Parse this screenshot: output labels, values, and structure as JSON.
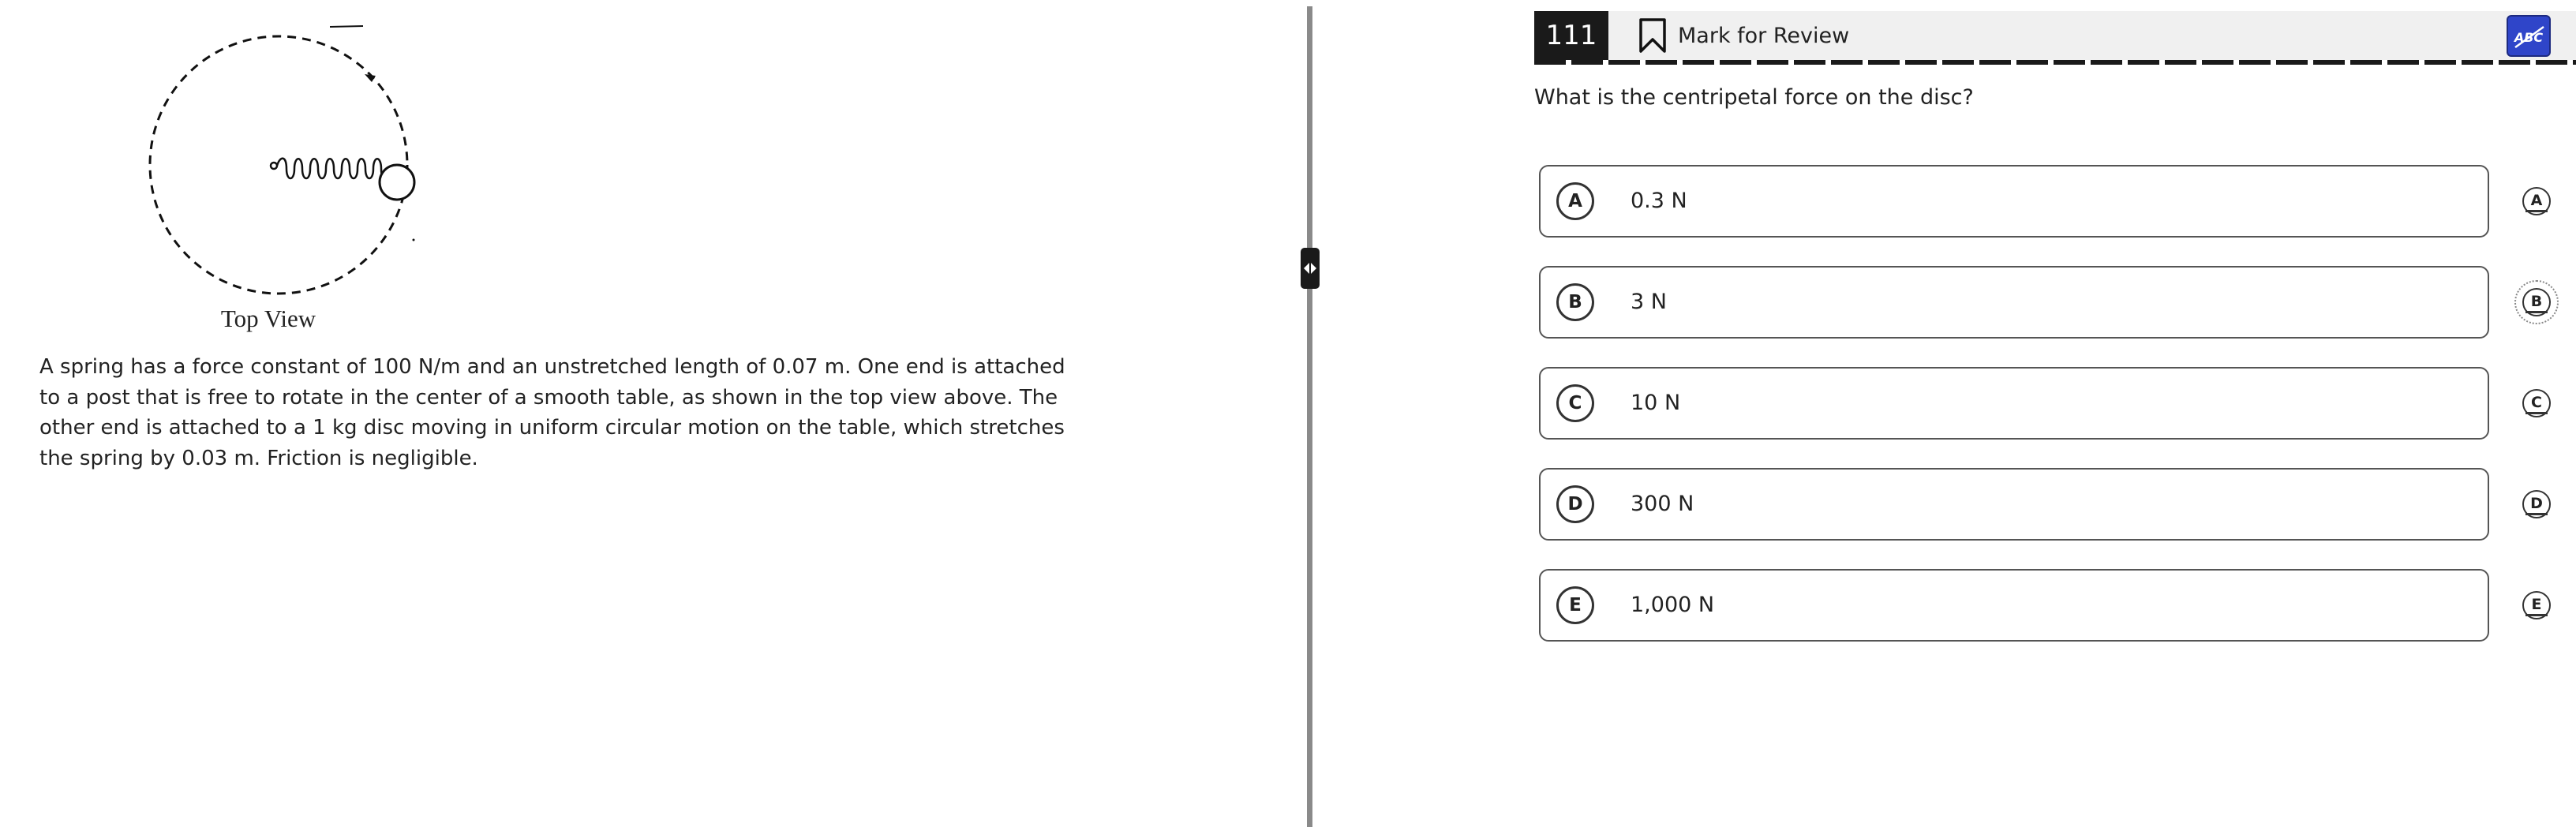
{
  "passage": {
    "figure_caption": "Top View",
    "text": "A spring has a force constant of 100 N/m and an unstretched length of 0.07 m. One end is attached to a post that is free to rotate in the center of a smooth table, as shown in the top view above. The other end is attached to a 1 kg disc moving in uniform circular motion on the table, which stretches the spring by 0.03 m. Friction is negligible."
  },
  "header": {
    "question_number": "111",
    "mark_for_review_label": "Mark for Review",
    "abc_toggle_label": "ABC"
  },
  "question": {
    "prompt": "What is the centripetal force on the disc?"
  },
  "choices": [
    {
      "letter": "A",
      "text": "0.3 N"
    },
    {
      "letter": "B",
      "text": "3 N"
    },
    {
      "letter": "C",
      "text": "10 N"
    },
    {
      "letter": "D",
      "text": "300 N"
    },
    {
      "letter": "E",
      "text": "1,000 N"
    }
  ],
  "icons": {
    "bookmark": "bookmark-icon",
    "resize_handle": "resize-arrows-icon",
    "abc_toggle": "answer-eliminator-icon"
  },
  "colors": {
    "question_number_bg": "#1a1a1a",
    "abc_toggle_bg": "#2f45c9",
    "header_bg": "#f0f0f0",
    "divider": "#8a8a8a"
  }
}
